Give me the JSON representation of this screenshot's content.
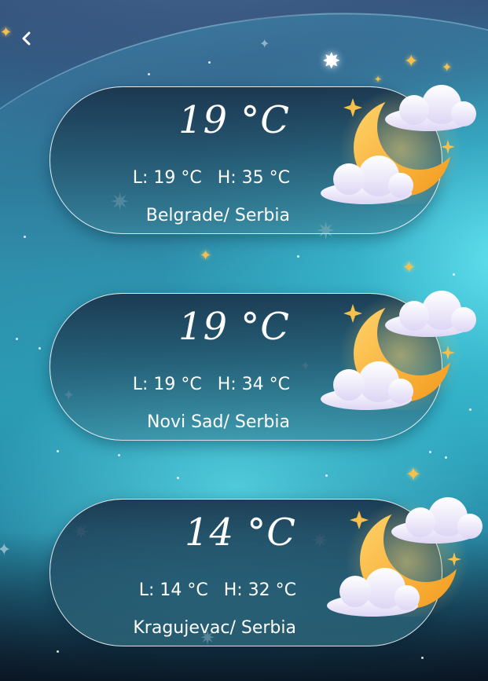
{
  "header": {
    "back_icon": "chevron-left-icon"
  },
  "colors": {
    "card_border": "#ffffff",
    "moon": "#f7b42c",
    "cloud": "#f2eefc",
    "star": "#f7c04a"
  },
  "cards": [
    {
      "temperature": "19 °C",
      "low": "L: 19 °C",
      "high": "H: 35 °C",
      "location": "Belgrade/ Serbia",
      "icon": "moon-cloud-icon"
    },
    {
      "temperature": "19 °C",
      "low": "L: 19 °C",
      "high": "H: 34 °C",
      "location": "Novi Sad/ Serbia",
      "icon": "moon-cloud-icon"
    },
    {
      "temperature": "14 °C",
      "low": "L: 14 °C",
      "high": "H: 32 °C",
      "location": "Kragujevac/ Serbia",
      "icon": "moon-cloud-icon"
    }
  ]
}
